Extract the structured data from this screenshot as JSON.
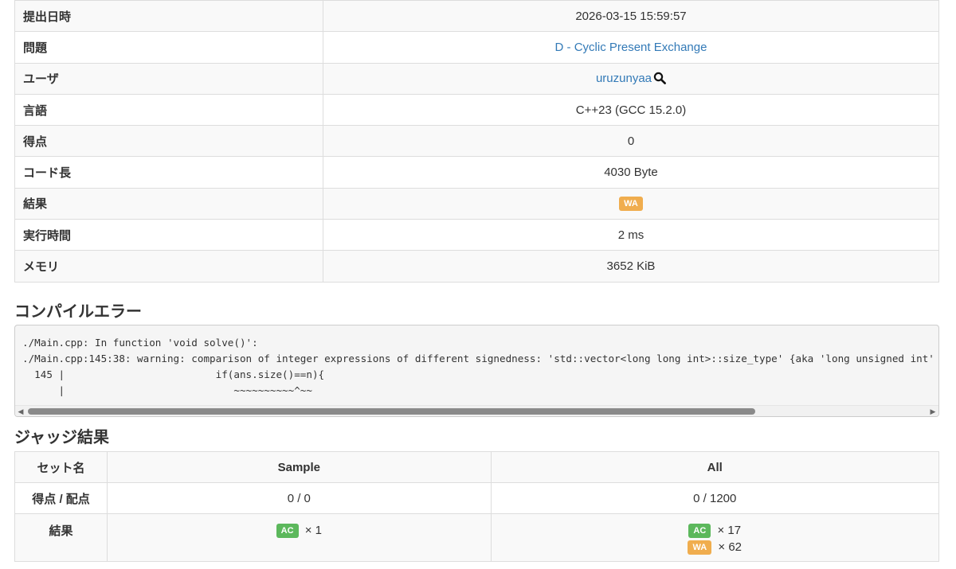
{
  "submission": {
    "rows": [
      {
        "label": "提出日時",
        "value": "2026-03-15 15:59:57"
      },
      {
        "label": "問題",
        "value": "D - Cyclic Present Exchange"
      },
      {
        "label": "ユーザ",
        "value": "uruzunyaa"
      },
      {
        "label": "言語",
        "value": "C++23 (GCC 15.2.0)"
      },
      {
        "label": "得点",
        "value": "0"
      },
      {
        "label": "コード長",
        "value": "4030 Byte"
      },
      {
        "label": "結果",
        "value": "WA"
      },
      {
        "label": "実行時間",
        "value": "2 ms"
      },
      {
        "label": "メモリ",
        "value": "3652 KiB"
      }
    ]
  },
  "compile_error": {
    "title": "コンパイルエラー",
    "lines": [
      "./Main.cpp: In function 'void solve()':",
      "./Main.cpp:145:38: warning: comparison of integer expressions of different signedness: 'std::vector<long long int>::size_type' {aka 'long unsigned int'",
      "  145 |                         if(ans.size()==n){",
      "      |                            ~~~~~~~~~~^~~"
    ]
  },
  "judge": {
    "title": "ジャッジ結果",
    "header": {
      "set_name": "セット名",
      "sample": "Sample",
      "all": "All"
    },
    "score_row": {
      "label": "得点 / 配点",
      "sample": "0 / 0",
      "all": "0 / 1200"
    },
    "result_row": {
      "label": "結果",
      "sample": [
        {
          "status": "AC",
          "count": "× 1"
        }
      ],
      "all": [
        {
          "status": "AC",
          "count": "× 17"
        },
        {
          "status": "WA",
          "count": "× 62"
        }
      ]
    }
  },
  "colors": {
    "link": "#337ab7",
    "ac": "#5cb85c",
    "wa": "#f0ad4e"
  },
  "icons": {
    "user_search": "search-icon",
    "scroll_left": "arrow-left-icon",
    "scroll_right": "arrow-right-icon"
  }
}
